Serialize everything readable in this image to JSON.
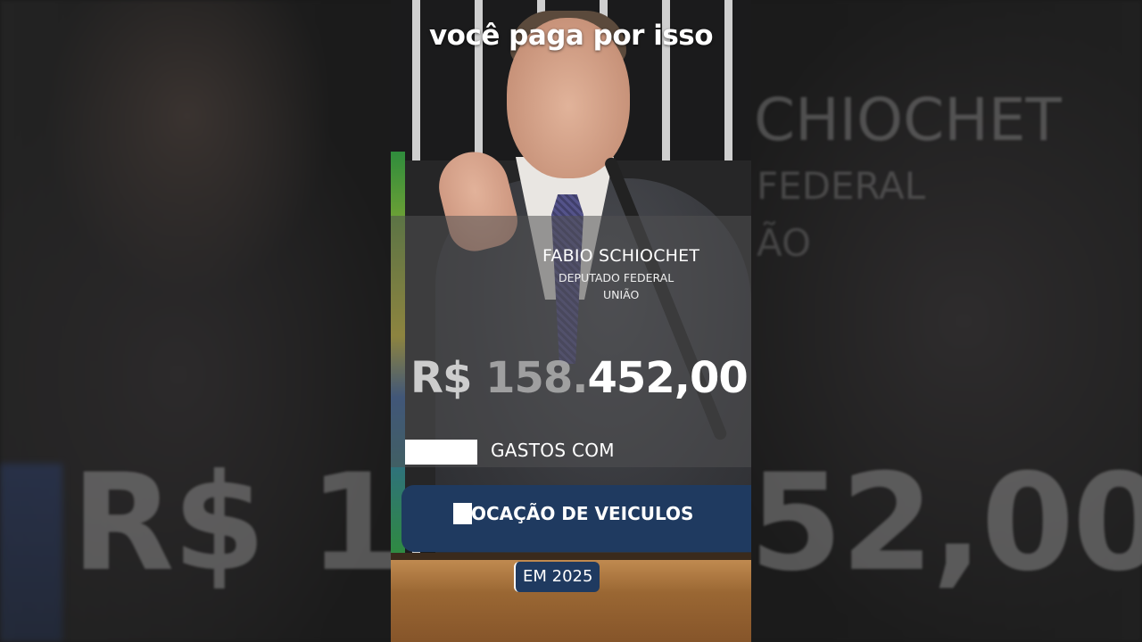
{
  "caption": "você paga por isso",
  "politician": {
    "name": "FABIO SCHIOCHET",
    "role": "DEPUTADO FEDERAL",
    "party": "UNIÃO"
  },
  "amount": {
    "part1": "R$ ",
    "part2": "158.",
    "part3": "452,00"
  },
  "expense": {
    "label": "GASTOS COM",
    "category": "OCAÇÃO DE VEICULOS",
    "year": "EM 2025"
  },
  "background": {
    "amount_left": "R$ 15",
    "amount_right": "52,00",
    "name_fragment": "CHIOCHET",
    "role_fragment": "FEDERAL",
    "party_fragment": "ÃO"
  },
  "colors": {
    "panel_blue": "#1f3a60",
    "text": "#ffffff"
  }
}
